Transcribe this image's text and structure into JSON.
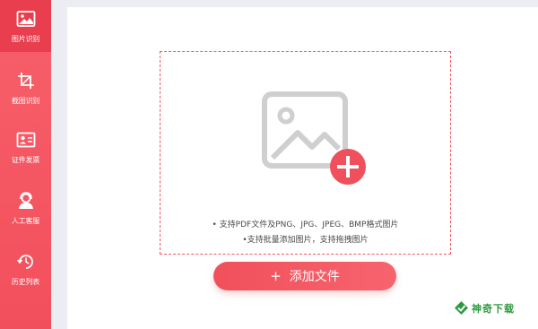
{
  "sidebar": {
    "items": [
      {
        "label": "图片识别",
        "icon": "image-icon",
        "active": true
      },
      {
        "label": "截图识别",
        "icon": "crop-icon",
        "active": false
      },
      {
        "label": "证件发票",
        "icon": "id-card-icon",
        "active": false
      },
      {
        "label": "人工客服",
        "icon": "customer-service-icon",
        "active": false
      },
      {
        "label": "历史列表",
        "icon": "history-icon",
        "active": false
      }
    ]
  },
  "upload": {
    "hint_line1": "• 支持PDF文件及PNG、JPG、JPEG、BMP格式图片",
    "hint_line2": "•支持批量添加图片，支持拖拽图片",
    "button_plus": "+",
    "button_label": "添加文件"
  },
  "watermark": {
    "text": "神奇下载"
  },
  "colors": {
    "accent": "#f24f5c",
    "active_nav": "#e83e4d",
    "watermark_green": "#2e9a3f"
  }
}
